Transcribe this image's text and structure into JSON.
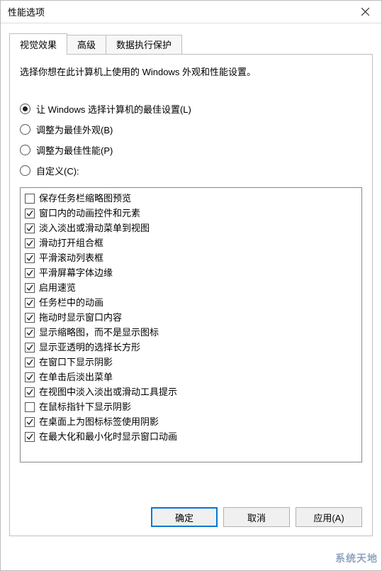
{
  "window": {
    "title": "性能选项"
  },
  "tabs": {
    "visual": "视觉效果",
    "advanced": "高级",
    "dep": "数据执行保护"
  },
  "description": "选择你想在此计算机上使用的 Windows 外观和性能设置。",
  "radios": {
    "best": "让 Windows 选择计算机的最佳设置(L)",
    "appearance": "调整为最佳外观(B)",
    "performance": "调整为最佳性能(P)",
    "custom": "自定义(C):"
  },
  "options": [
    {
      "checked": false,
      "label": "保存任务栏缩略图预览"
    },
    {
      "checked": true,
      "label": "窗口内的动画控件和元素"
    },
    {
      "checked": true,
      "label": "淡入淡出或滑动菜单到视图"
    },
    {
      "checked": true,
      "label": "滑动打开组合框"
    },
    {
      "checked": true,
      "label": "平滑滚动列表框"
    },
    {
      "checked": true,
      "label": "平滑屏幕字体边缘"
    },
    {
      "checked": true,
      "label": "启用速览"
    },
    {
      "checked": true,
      "label": "任务栏中的动画"
    },
    {
      "checked": true,
      "label": "拖动时显示窗口内容"
    },
    {
      "checked": true,
      "label": "显示缩略图，而不是显示图标"
    },
    {
      "checked": true,
      "label": "显示亚透明的选择长方形"
    },
    {
      "checked": true,
      "label": "在窗口下显示阴影"
    },
    {
      "checked": true,
      "label": "在单击后淡出菜单"
    },
    {
      "checked": true,
      "label": "在视图中淡入淡出或滑动工具提示"
    },
    {
      "checked": false,
      "label": "在鼠标指针下显示阴影"
    },
    {
      "checked": true,
      "label": "在桌面上为图标标签使用阴影"
    },
    {
      "checked": true,
      "label": "在最大化和最小化时显示窗口动画"
    }
  ],
  "buttons": {
    "ok": "确定",
    "cancel": "取消",
    "apply": "应用(A)"
  },
  "watermark": "系统天地"
}
